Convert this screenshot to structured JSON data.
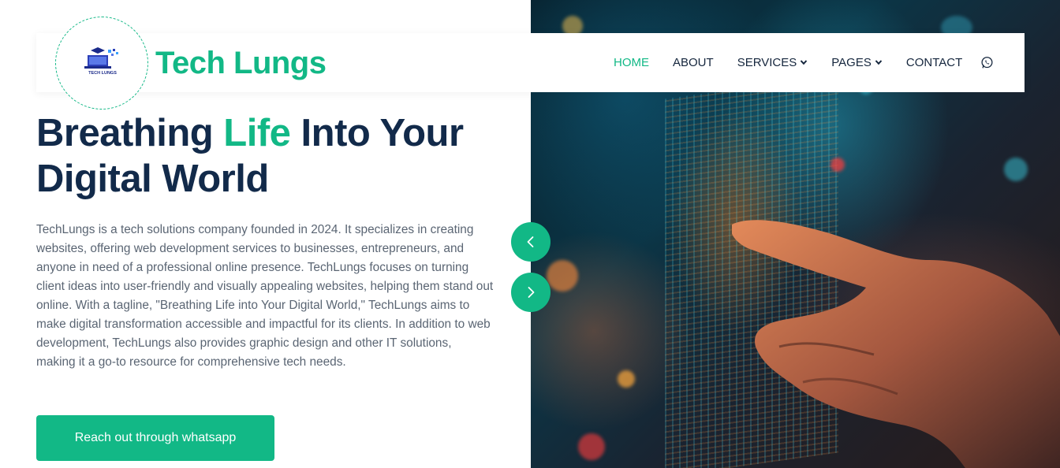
{
  "brand": {
    "name": "Tech Lungs",
    "logo_caption": "TECH LUNGS",
    "accent_color": "#12b886",
    "heading_color": "#122a4a"
  },
  "nav": {
    "items": [
      {
        "label": "HOME",
        "active": true
      },
      {
        "label": "ABOUT"
      },
      {
        "label": "SERVICES",
        "dropdown": true
      },
      {
        "label": "PAGES",
        "dropdown": true
      },
      {
        "label": "CONTACT"
      }
    ],
    "whatsapp_icon": "whatsapp-icon"
  },
  "hero": {
    "title_part1": "Breathing ",
    "title_accent": "Life",
    "title_part2": " Into Your Digital World",
    "description": "TechLungs is a tech solutions company founded in 2024. It specializes in creating websites, offering web development services to businesses, entrepreneurs, and anyone in need of a professional online presence. TechLungs focuses on turning client ideas into user-friendly and visually appealing websites, helping them stand out online. With a tagline, \"Breathing Life into Your Digital World,\" TechLungs aims to make digital transformation accessible and impactful for its clients. In addition to web development, TechLungs also provides graphic design and other IT solutions, making it a go-to resource for comprehensive tech needs.",
    "cta_label": "Reach out through whatsapp"
  },
  "slider": {
    "prev_icon": "chevron-left-icon",
    "next_icon": "chevron-right-icon"
  }
}
